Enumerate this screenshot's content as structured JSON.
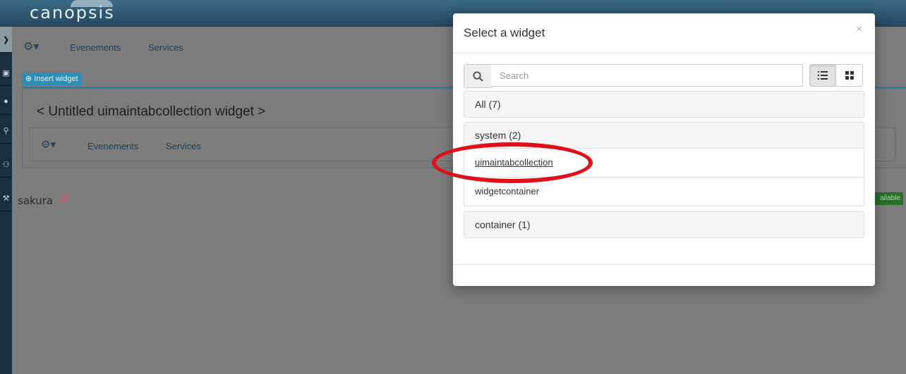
{
  "app": {
    "brand": "canopsis"
  },
  "leftbar": {
    "icons": [
      "chevron-right-icon",
      "monitor-icon",
      "users-icon",
      "wrench-link-icon",
      "network-icon",
      "wrench-icon"
    ]
  },
  "nav": {
    "links": [
      "Evenements",
      "Services"
    ]
  },
  "toolbar": {
    "insert_widget": "Insert widget"
  },
  "panel": {
    "title": "< Untitled uimaintabcollection widget >",
    "links": [
      "Evenements",
      "Services"
    ]
  },
  "footer": {
    "sakura": "sakura",
    "badge": "ailable"
  },
  "modal": {
    "title": "Select a widget",
    "close": "×",
    "search": {
      "placeholder": "Search",
      "value": ""
    },
    "groups": [
      {
        "label": "All (7)",
        "items": []
      },
      {
        "label": "system (2)",
        "items": [
          "uimaintabcollection",
          "widgetcontainer"
        ]
      },
      {
        "label": "container (1)",
        "items": []
      }
    ]
  },
  "colors": {
    "annotation": "#e0101a",
    "accent": "#2e8fb6",
    "topbar": "#2f5972"
  }
}
